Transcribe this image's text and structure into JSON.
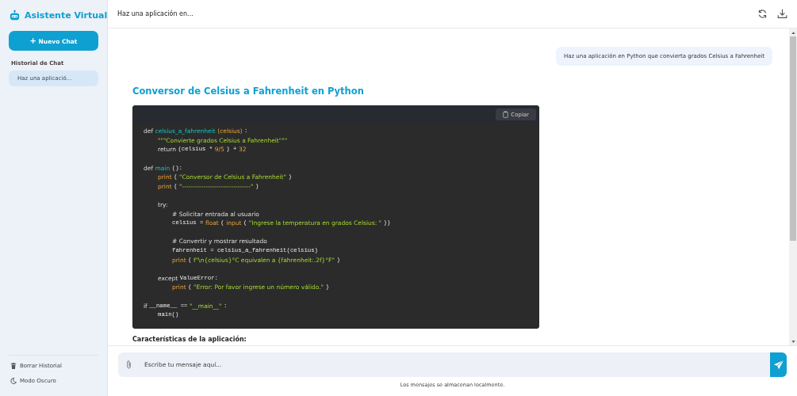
{
  "sidebar": {
    "app_title": "Asistente Virtual",
    "new_chat_button": "Nuevo Chat",
    "new_chat_icon": "+",
    "history_heading": "Historial de Chat",
    "history_items": [
      {
        "label": "Haz una aplicació...",
        "selected": true
      }
    ],
    "footer_items": [
      {
        "kind": "trash",
        "label": "Borrar Historial"
      },
      {
        "kind": "moon",
        "label": "Modo Oscuro"
      }
    ]
  },
  "header": {
    "title": "Haz una aplicación en..."
  },
  "messages": [
    {
      "kind": "user",
      "text": "Haz una aplicación en Python que convierta grados Celsius a Fahrenheit"
    }
  ],
  "answer": {
    "heading": "Conversor de Celsius a Fahrenheit en Python",
    "copy_button": "Copiar",
    "code": [
      {
        "kind": "code",
        "tokens": [
          {
            "kind": "kw",
            "t": "def"
          },
          {
            "kind": "fn",
            "t": "celsius_a_fahrenheit"
          },
          {
            "kind": "arg",
            "t": "(celsius)"
          },
          {
            "kind": "mono",
            "t": ":"
          }
        ],
        "children": [
          {
            "kind": "code",
            "tokens": [
              {
                "kind": "str",
                "t": "\"\"\"Convierte grados Celsius a Fahrenheit\"\"\""
              }
            ]
          },
          {
            "kind": "code",
            "tokens": [
              {
                "kind": "kw",
                "t": "return"
              },
              {
                "kind": "mono",
                "t": "(celsius *"
              },
              {
                "kind": "num",
                "t": "9/5"
              },
              {
                "kind": "mono",
                "t": ") +"
              },
              {
                "kind": "num",
                "t": "32"
              }
            ]
          }
        ]
      },
      {
        "kind": "blank"
      },
      {
        "kind": "code",
        "tokens": [
          {
            "kind": "kw",
            "t": "def"
          },
          {
            "kind": "fn",
            "t": "main"
          },
          {
            "kind": "mono",
            "t": "():"
          }
        ],
        "children": [
          {
            "kind": "code",
            "tokens": [
              {
                "kind": "arg",
                "t": "print"
              },
              {
                "kind": "mono",
                "t": "("
              },
              {
                "kind": "str",
                "t": "\"Conversor de Celsius a Fahrenheit\""
              },
              {
                "kind": "mono",
                "t": ")"
              }
            ]
          },
          {
            "kind": "code",
            "tokens": [
              {
                "kind": "arg",
                "t": "print"
              },
              {
                "kind": "mono",
                "t": "("
              },
              {
                "kind": "str",
                "t": "\"--------------------------------\""
              },
              {
                "kind": "mono",
                "t": ")"
              }
            ]
          },
          {
            "kind": "blank"
          },
          {
            "kind": "code",
            "tokens": [
              {
                "kind": "kw",
                "t": "try:"
              }
            ],
            "children": [
              {
                "kind": "code",
                "tokens": [
                  {
                    "kind": "cmt",
                    "t": "# Solicitar entrada al usuario"
                  }
                ]
              },
              {
                "kind": "code",
                "tokens": [
                  {
                    "kind": "mono",
                    "t": "celsius ="
                  },
                  {
                    "kind": "arg",
                    "t": "float"
                  },
                  {
                    "kind": "mono",
                    "t": "("
                  },
                  {
                    "kind": "arg",
                    "t": "input"
                  },
                  {
                    "kind": "mono",
                    "t": "("
                  },
                  {
                    "kind": "str",
                    "t": "\"Ingrese la temperatura en grados Celsius: \""
                  },
                  {
                    "kind": "mono",
                    "t": "))"
                  }
                ]
              },
              {
                "kind": "blank"
              },
              {
                "kind": "code",
                "tokens": [
                  {
                    "kind": "cmt",
                    "t": "# Convertir y mostrar resultado"
                  }
                ]
              },
              {
                "kind": "code",
                "tokens": [
                  {
                    "kind": "mono",
                    "t": "fahrenheit = celsius_a_fahrenheit(celsius)"
                  }
                ]
              },
              {
                "kind": "code",
                "tokens": [
                  {
                    "kind": "arg",
                    "t": "print"
                  },
                  {
                    "kind": "mono",
                    "t": "("
                  },
                  {
                    "kind": "str",
                    "t": "f\"\\n{celsius}°C equivalen a {fahrenheit:.2f}°F\""
                  },
                  {
                    "kind": "mono",
                    "t": ")"
                  }
                ]
              }
            ]
          },
          {
            "kind": "blank"
          },
          {
            "kind": "code",
            "tokens": [
              {
                "kind": "kw",
                "t": "except"
              },
              {
                "kind": "mono",
                "t": "ValueError:"
              }
            ],
            "children": [
              {
                "kind": "code",
                "tokens": [
                  {
                    "kind": "arg",
                    "t": "print"
                  },
                  {
                    "kind": "mono",
                    "t": "("
                  },
                  {
                    "kind": "str",
                    "t": "\"Error: Por favor ingrese un número válido.\""
                  },
                  {
                    "kind": "mono",
                    "t": ")"
                  }
                ]
              }
            ]
          }
        ]
      },
      {
        "kind": "blank"
      },
      {
        "kind": "code",
        "tokens": [
          {
            "kind": "kw",
            "t": "if"
          },
          {
            "kind": "mono",
            "t": "__name__ =="
          },
          {
            "kind": "str",
            "t": "\"__main__\""
          },
          {
            "kind": "mono",
            "t": ":"
          }
        ],
        "children": [
          {
            "kind": "code",
            "tokens": [
              {
                "kind": "mono",
                "t": "main()"
              }
            ]
          }
        ]
      }
    ],
    "subheading": "Características de la aplicación:"
  },
  "composer": {
    "placeholder": "Escribe tu mensaje aquí...",
    "note": "Los mensajes se almacenan localmente."
  }
}
